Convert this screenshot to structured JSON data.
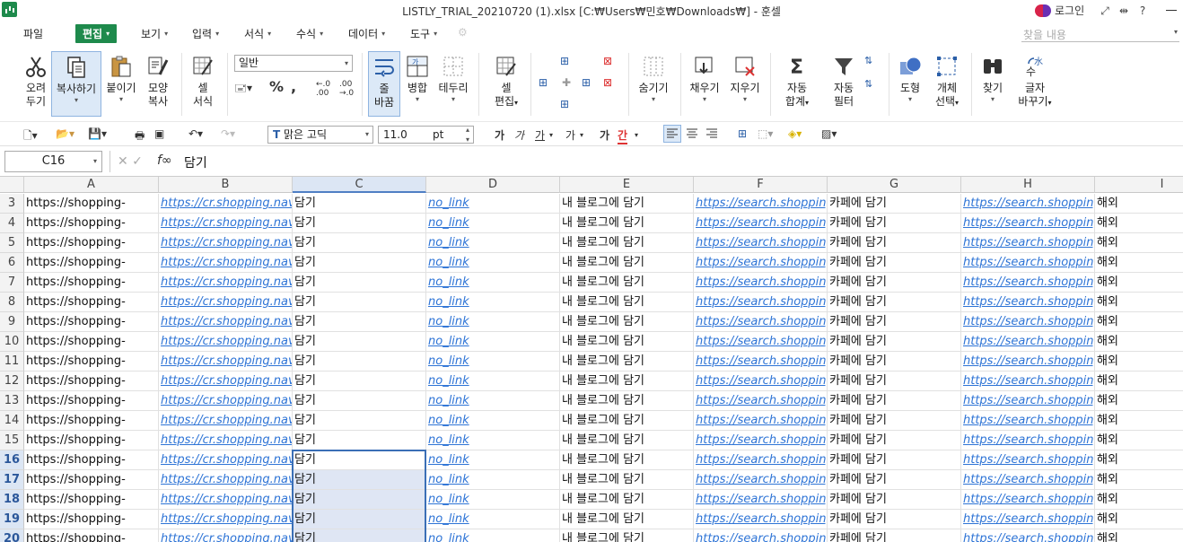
{
  "window": {
    "title": "LISTLY_TRIAL_20210720 (1).xlsx [C:₩Users₩민호₩Downloads₩] - 훈셀",
    "login_label": "로그인"
  },
  "menu": {
    "items": [
      {
        "label": "파일",
        "dropdown": false
      },
      {
        "label": "편집",
        "dropdown": true,
        "active": true
      },
      {
        "label": "보기",
        "dropdown": true
      },
      {
        "label": "입력",
        "dropdown": true
      },
      {
        "label": "서식",
        "dropdown": true
      },
      {
        "label": "수식",
        "dropdown": true
      },
      {
        "label": "데이터",
        "dropdown": true
      },
      {
        "label": "도구",
        "dropdown": true
      }
    ],
    "search_placeholder": "찾을 내용"
  },
  "ribbon": {
    "cut": [
      "오려",
      "두기"
    ],
    "copy": "복사하기",
    "paste": "붙이기",
    "format_painter": [
      "모양",
      "복사"
    ],
    "cell_format": [
      "셀",
      "서식"
    ],
    "number_format": "일반",
    "wrap_text": [
      "줄",
      "바꿈"
    ],
    "merge": "병합",
    "border": "테두리",
    "cell_edit": [
      "셀",
      "편집"
    ],
    "hide": "숨기기",
    "fill": "채우기",
    "clear": "지우기",
    "autosum": [
      "자동",
      "합계"
    ],
    "autofilter": [
      "자동",
      "필터"
    ],
    "shape": "도형",
    "select_object": [
      "개체",
      "선택"
    ],
    "find": "찾기",
    "replace": [
      "글자",
      "바꾸기"
    ],
    "merge_icon_text": "가"
  },
  "toolbar": {
    "font_name": "맑은 고딕",
    "font_size": "11.0",
    "font_unit": "pt",
    "bold": "가",
    "italic": "가",
    "underline": "가",
    "strike": "가",
    "superscript": "가",
    "font_color": "간"
  },
  "formula": {
    "name_box": "C16",
    "value": "담기"
  },
  "grid": {
    "columns": [
      "A",
      "B",
      "C",
      "D",
      "E",
      "F",
      "G",
      "H",
      "I"
    ],
    "selected_column": "C",
    "row_numbers": [
      3,
      4,
      5,
      6,
      7,
      8,
      9,
      10,
      11,
      12,
      13,
      14,
      15,
      16,
      17,
      18,
      19,
      20
    ],
    "selected_rows": [
      16,
      17,
      18,
      19,
      20
    ],
    "active_cell": "C16",
    "row_template": {
      "A": "https://shopping-",
      "B": "https://cr.shopping.nav",
      "C": "담기",
      "D": "no_link",
      "E": "내 블로그에 담기",
      "F": "https://search.shopping",
      "G": "카페에 담기",
      "H": "https://search.shopping",
      "I": "해외"
    },
    "link_columns": [
      "B",
      "D",
      "F",
      "H"
    ]
  }
}
